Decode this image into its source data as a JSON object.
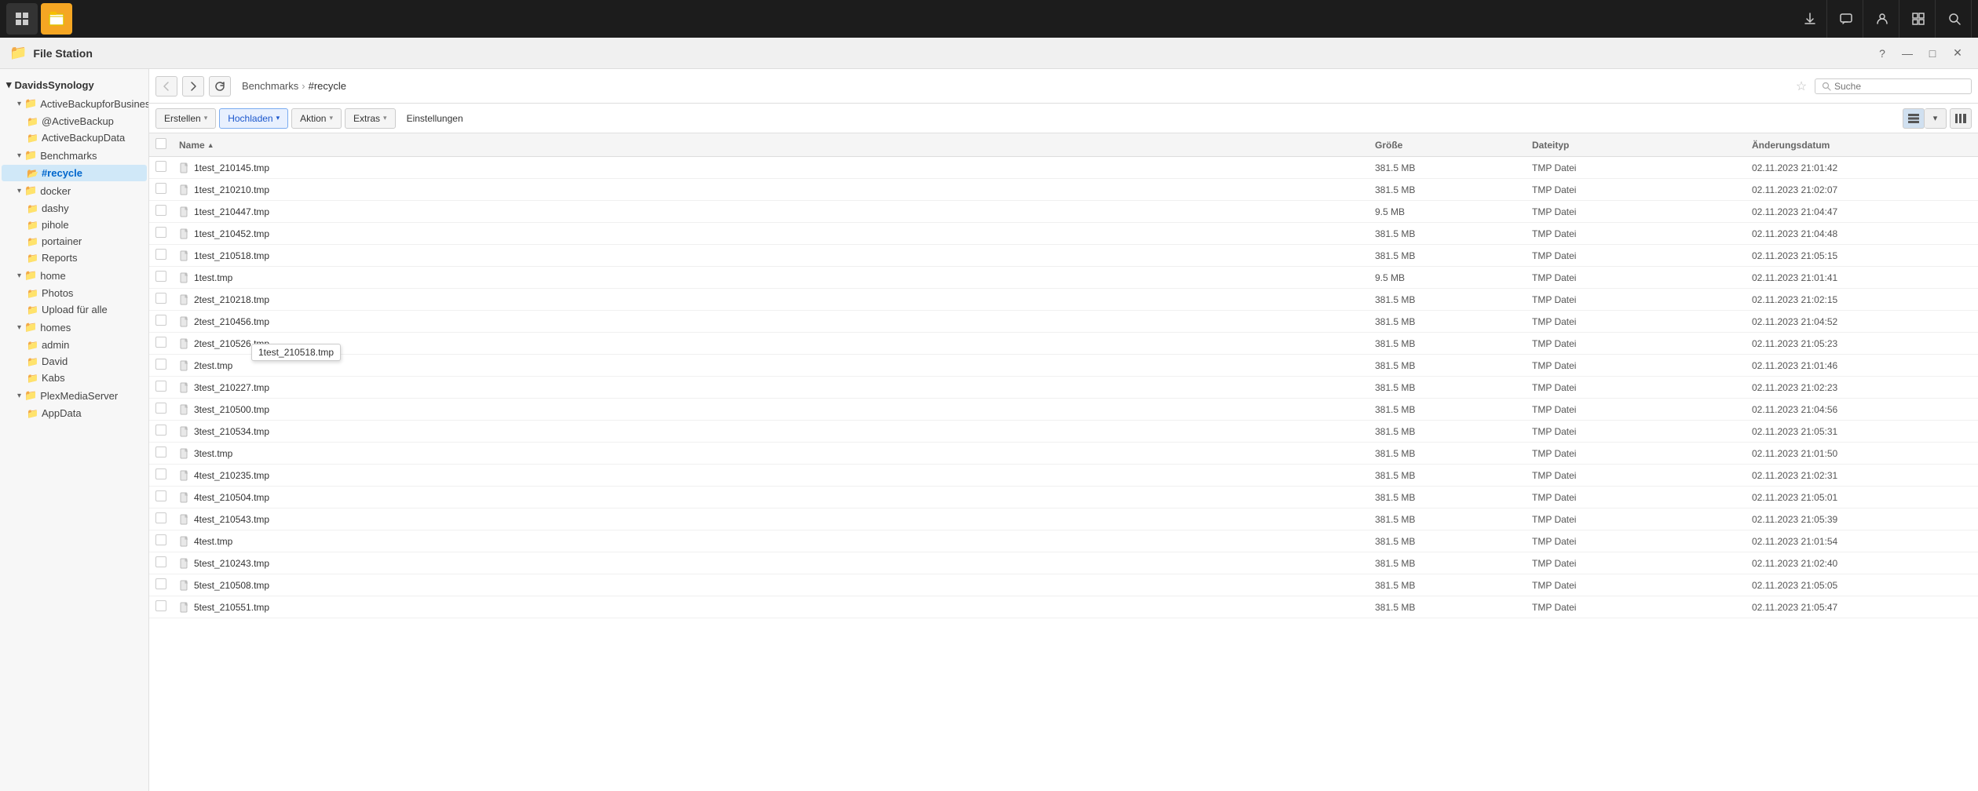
{
  "app": {
    "title": "File Station",
    "icon": "📁"
  },
  "taskbar": {
    "apps": [
      {
        "name": "grid-menu",
        "label": "⊞",
        "active": false
      },
      {
        "name": "file-station",
        "label": "📁",
        "active": true
      }
    ],
    "right_icons": [
      {
        "name": "download-icon",
        "symbol": "⬇"
      },
      {
        "name": "chat-icon",
        "symbol": "💬"
      },
      {
        "name": "user-icon",
        "symbol": "👤"
      },
      {
        "name": "windows-icon",
        "symbol": "⊟"
      },
      {
        "name": "search-taskbar-icon",
        "symbol": "🔍"
      }
    ]
  },
  "title_bar": {
    "title": "File Station",
    "help_label": "?",
    "minimize_label": "—",
    "maximize_label": "□",
    "close_label": "✕"
  },
  "sidebar": {
    "root_label": "DavidsSynology",
    "groups": [
      {
        "name": "ActiveBackupforBusiness",
        "expanded": true,
        "items": [
          {
            "label": "@ActiveBackup",
            "indent": 1
          },
          {
            "label": "ActiveBackupData",
            "indent": 1
          }
        ]
      },
      {
        "name": "Benchmarks",
        "expanded": true,
        "items": [
          {
            "label": "#recycle",
            "indent": 1,
            "active": true
          }
        ]
      },
      {
        "name": "docker",
        "expanded": true,
        "items": [
          {
            "label": "dashy",
            "indent": 1
          },
          {
            "label": "pihole",
            "indent": 1
          },
          {
            "label": "portainer",
            "indent": 1
          },
          {
            "label": "Reports",
            "indent": 1
          }
        ]
      },
      {
        "name": "home",
        "expanded": true,
        "items": [
          {
            "label": "Photos",
            "indent": 1
          },
          {
            "label": "Upload für alle",
            "indent": 1
          }
        ]
      },
      {
        "name": "homes",
        "expanded": true,
        "items": [
          {
            "label": "admin",
            "indent": 1
          },
          {
            "label": "David",
            "indent": 1
          },
          {
            "label": "Kabs",
            "indent": 1
          }
        ]
      },
      {
        "name": "PlexMediaServer",
        "expanded": true,
        "items": [
          {
            "label": "AppData",
            "indent": 1
          }
        ]
      }
    ]
  },
  "toolbar": {
    "back_label": "‹",
    "forward_label": "›",
    "refresh_label": "↻",
    "breadcrumb": {
      "parts": [
        "Benchmarks",
        "#recycle"
      ],
      "separator": "›"
    },
    "star_label": "★",
    "search_placeholder": "Suche"
  },
  "actions": {
    "erstellen_label": "Erstellen",
    "hochladen_label": "Hochladen",
    "aktion_label": "Aktion",
    "extras_label": "Extras",
    "einstellungen_label": "Einstellungen",
    "dropdown_arrow": "▾"
  },
  "file_list": {
    "columns": {
      "name": "Name",
      "size": "Größe",
      "type": "Dateityp",
      "date": "Änderungsdatum",
      "sort_arrow": "▲"
    },
    "files": [
      {
        "name": "1test_210145.tmp",
        "size": "381.5 MB",
        "type": "TMP Datei",
        "date": "02.11.2023 21:01:42"
      },
      {
        "name": "1test_210210.tmp",
        "size": "381.5 MB",
        "type": "TMP Datei",
        "date": "02.11.2023 21:02:07"
      },
      {
        "name": "1test_210447.tmp",
        "size": "9.5 MB",
        "type": "TMP Datei",
        "date": "02.11.2023 21:04:47"
      },
      {
        "name": "1test_210452.tmp",
        "size": "381.5 MB",
        "type": "TMP Datei",
        "date": "02.11.2023 21:04:48"
      },
      {
        "name": "1test_210518.tmp",
        "size": "381.5 MB",
        "type": "TMP Datei",
        "date": "02.11.2023 21:05:15"
      },
      {
        "name": "1test.tmp",
        "size": "9.5 MB",
        "type": "TMP Datei",
        "date": "02.11.2023 21:01:41"
      },
      {
        "name": "2test_210218.tmp",
        "size": "381.5 MB",
        "type": "TMP Datei",
        "date": "02.11.2023 21:02:15"
      },
      {
        "name": "2test_210456.tmp",
        "size": "381.5 MB",
        "type": "TMP Datei",
        "date": "02.11.2023 21:04:52"
      },
      {
        "name": "2test_210526.tmp",
        "size": "381.5 MB",
        "type": "TMP Datei",
        "date": "02.11.2023 21:05:23"
      },
      {
        "name": "2test.tmp",
        "size": "381.5 MB",
        "type": "TMP Datei",
        "date": "02.11.2023 21:01:46"
      },
      {
        "name": "3test_210227.tmp",
        "size": "381.5 MB",
        "type": "TMP Datei",
        "date": "02.11.2023 21:02:23"
      },
      {
        "name": "3test_210500.tmp",
        "size": "381.5 MB",
        "type": "TMP Datei",
        "date": "02.11.2023 21:04:56"
      },
      {
        "name": "3test_210534.tmp",
        "size": "381.5 MB",
        "type": "TMP Datei",
        "date": "02.11.2023 21:05:31"
      },
      {
        "name": "3test.tmp",
        "size": "381.5 MB",
        "type": "TMP Datei",
        "date": "02.11.2023 21:01:50"
      },
      {
        "name": "4test_210235.tmp",
        "size": "381.5 MB",
        "type": "TMP Datei",
        "date": "02.11.2023 21:02:31"
      },
      {
        "name": "4test_210504.tmp",
        "size": "381.5 MB",
        "type": "TMP Datei",
        "date": "02.11.2023 21:05:01"
      },
      {
        "name": "4test_210543.tmp",
        "size": "381.5 MB",
        "type": "TMP Datei",
        "date": "02.11.2023 21:05:39"
      },
      {
        "name": "4test.tmp",
        "size": "381.5 MB",
        "type": "TMP Datei",
        "date": "02.11.2023 21:01:54"
      },
      {
        "name": "5test_210243.tmp",
        "size": "381.5 MB",
        "type": "TMP Datei",
        "date": "02.11.2023 21:02:40"
      },
      {
        "name": "5test_210508.tmp",
        "size": "381.5 MB",
        "type": "TMP Datei",
        "date": "02.11.2023 21:05:05"
      },
      {
        "name": "5test_210551.tmp",
        "size": "381.5 MB",
        "type": "TMP Datei",
        "date": "02.11.2023 21:05:47"
      }
    ],
    "tooltip": {
      "visible": true,
      "text": "1test_210518.tmp",
      "row_index": 4
    }
  },
  "view": {
    "list_view_label": "≡",
    "grid_view_label": "⊞",
    "more_label": "▾"
  }
}
